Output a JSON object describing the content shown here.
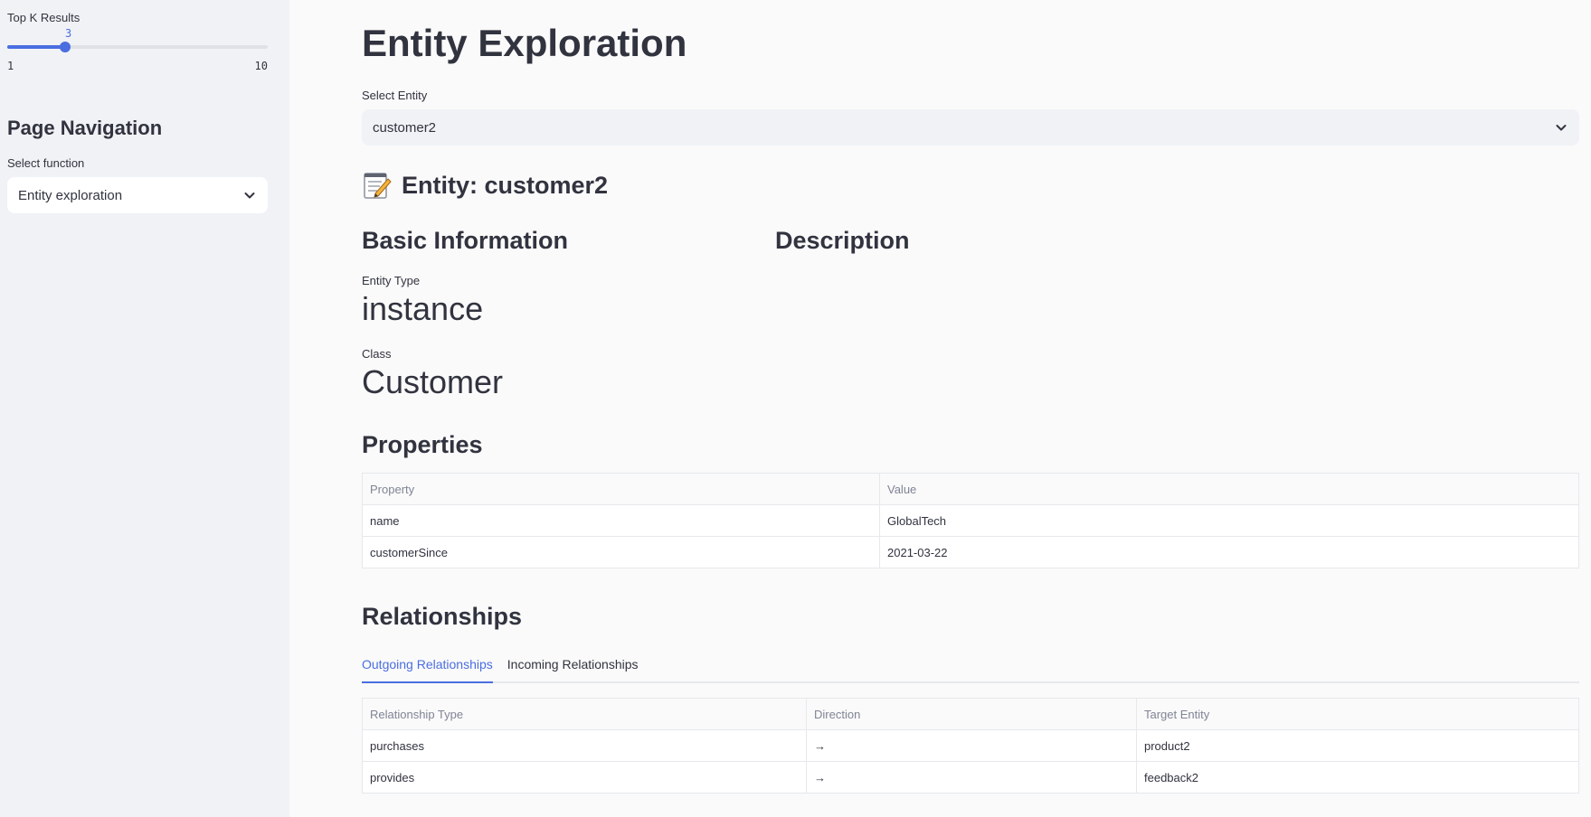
{
  "sidebar": {
    "top_k": {
      "label": "Top K Results",
      "value": "3",
      "min": "1",
      "max": "10",
      "fraction": 0.2222
    },
    "nav_heading": "Page Navigation",
    "select_label": "Select function",
    "select_value": "Entity exploration"
  },
  "main": {
    "title": "Entity Exploration",
    "entity_select": {
      "label": "Select Entity",
      "value": "customer2"
    },
    "entity_heading": "Entity: customer2",
    "basic_info": {
      "heading": "Basic Information",
      "entity_type_label": "Entity Type",
      "entity_type_value": "instance",
      "class_label": "Class",
      "class_value": "Customer"
    },
    "description_heading": "Description",
    "properties": {
      "heading": "Properties",
      "columns": [
        "Property",
        "Value"
      ],
      "rows": [
        [
          "name",
          "GlobalTech"
        ],
        [
          "customerSince",
          "2021-03-22"
        ]
      ]
    },
    "relationships": {
      "heading": "Relationships",
      "tabs": [
        "Outgoing Relationships",
        "Incoming Relationships"
      ],
      "active_tab": "Outgoing Relationships",
      "columns": [
        "Relationship Type",
        "Direction",
        "Target Entity"
      ],
      "rows": [
        [
          "purchases",
          "→",
          "product2"
        ],
        [
          "provides",
          "→",
          "feedback2"
        ]
      ]
    }
  },
  "icons": {
    "entity_heading_icon": "memo-icon",
    "dropdown_icon": "chevron-down-icon"
  },
  "colors": {
    "accent": "#4a6ee0",
    "sidebar_bg": "#f0f2f6",
    "main_bg": "#fafafa"
  }
}
